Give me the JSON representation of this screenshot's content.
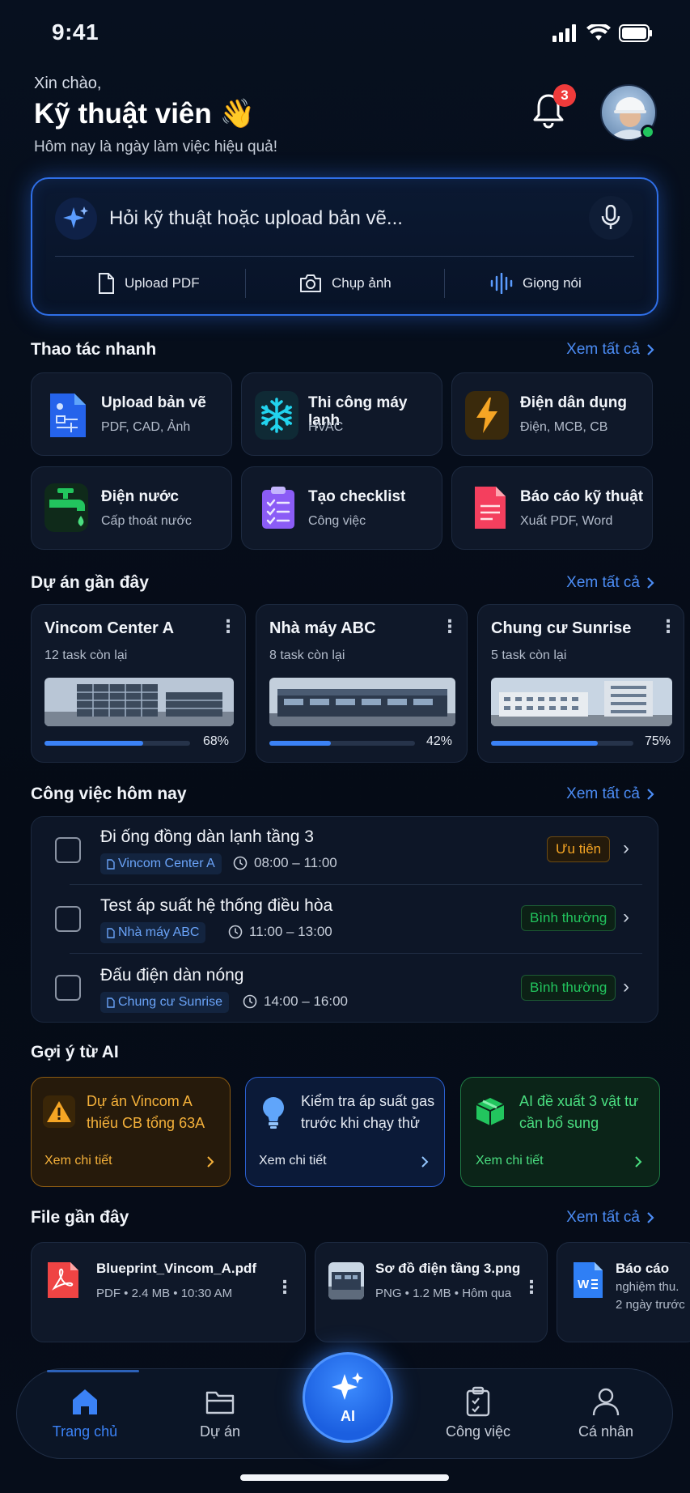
{
  "status_bar": {
    "time": "9:41"
  },
  "header": {
    "greeting": "Xin chào,",
    "title": "Kỹ thuật viên 👋",
    "subtitle": "Hôm nay là ngày làm việc hiệu quả!",
    "notification_count": "3"
  },
  "ai_input": {
    "placeholder": "Hỏi kỹ thuật hoặc upload bản vẽ...",
    "actions": [
      {
        "label": "Upload PDF",
        "icon": "file-icon"
      },
      {
        "label": "Chụp ảnh",
        "icon": "camera-icon"
      },
      {
        "label": "Giọng nói",
        "icon": "voice-wave-icon"
      }
    ]
  },
  "quick_actions": {
    "title": "Thao tác nhanh",
    "see_all": "Xem tất cả",
    "items": [
      {
        "title": "Upload bản vẽ",
        "sub": "PDF, CAD, Ảnh",
        "icon": "blueprint-icon",
        "color": "#2563eb"
      },
      {
        "title": "Thi công máy lạnh",
        "sub": "HVAC",
        "icon": "snowflake-icon",
        "color": "#22d3ee"
      },
      {
        "title": "Điện dân dụng",
        "sub": "Điện, MCB, CB",
        "icon": "lightning-icon",
        "color": "#f5a524"
      },
      {
        "title": "Điện nước",
        "sub": "Cấp thoát nước",
        "icon": "faucet-icon",
        "color": "#22c55e"
      },
      {
        "title": "Tạo checklist",
        "sub": "Công việc",
        "icon": "checklist-icon",
        "color": "#8b5cf6"
      },
      {
        "title": "Báo cáo kỹ thuật",
        "sub": "Xuất PDF, Word",
        "icon": "report-icon",
        "color": "#f43f5e"
      }
    ]
  },
  "projects": {
    "title": "Dự án gần đây",
    "see_all": "Xem tất cả",
    "items": [
      {
        "name": "Vincom Center A",
        "tasks": "12 task còn lại",
        "progress": 68,
        "progress_label": "68%"
      },
      {
        "name": "Nhà máy ABC",
        "tasks": "8 task còn lại",
        "progress": 42,
        "progress_label": "42%"
      },
      {
        "name": "Chung cư Sunrise",
        "tasks": "5 task còn lại",
        "progress": 75,
        "progress_label": "75%"
      }
    ]
  },
  "tasks": {
    "title": "Công việc hôm nay",
    "see_all": "Xem tất cả",
    "items": [
      {
        "title": "Đi ống đồng dàn lạnh tầng 3",
        "project": "Vincom Center A",
        "time": "08:00 – 11:00",
        "priority": "Ưu tiên"
      },
      {
        "title": "Test áp suất hệ thống điều hòa",
        "project": "Nhà máy ABC",
        "time": "11:00 – 13:00",
        "priority": "Bình thường"
      },
      {
        "title": "Đấu điện dàn nóng",
        "project": "Chung cư Sunrise",
        "time": "14:00 – 16:00",
        "priority": "Bình thường"
      }
    ]
  },
  "ai_suggestions": {
    "title": "Gợi ý từ AI",
    "items": [
      {
        "text": "Dự án Vincom A thiếu CB tổng 63A",
        "link": "Xem chi tiết",
        "icon": "warning-icon",
        "color": "#f5a524"
      },
      {
        "text": "Kiểm tra áp suất gas trước khi chạy thử",
        "link": "Xem chi tiết",
        "icon": "lightbulb-icon",
        "color": "#3b82f6"
      },
      {
        "text": "AI đề xuất 3 vật tư cần bổ sung",
        "link": "Xem chi tiết",
        "icon": "box-icon",
        "color": "#22c55e"
      }
    ]
  },
  "files": {
    "title": "File gần đây",
    "see_all": "Xem tất cả",
    "items": [
      {
        "name": "Blueprint_Vincom_A.pdf",
        "meta": "PDF • 2.4 MB • 10:30 AM",
        "icon": "pdf-icon"
      },
      {
        "name": "Sơ đồ điện tầng 3.png",
        "meta": "PNG • 1.2 MB • Hôm qua",
        "icon": "image-thumb-icon"
      },
      {
        "name": "Báo cáo",
        "meta": "nghiệm thu.",
        "meta2": "2 ngày trước",
        "icon": "word-icon"
      }
    ]
  },
  "nav": {
    "items": [
      {
        "label": "Trang chủ",
        "icon": "home-icon",
        "active": true
      },
      {
        "label": "Dự án",
        "icon": "folder-icon"
      },
      {
        "label": "AI",
        "icon": "sparkle-icon"
      },
      {
        "label": "Công việc",
        "icon": "clipboard-icon"
      },
      {
        "label": "Cá nhân",
        "icon": "user-icon"
      }
    ]
  },
  "colors": {
    "accent": "#3b82f6",
    "background": "#060d1a",
    "card": "#0f1829"
  }
}
